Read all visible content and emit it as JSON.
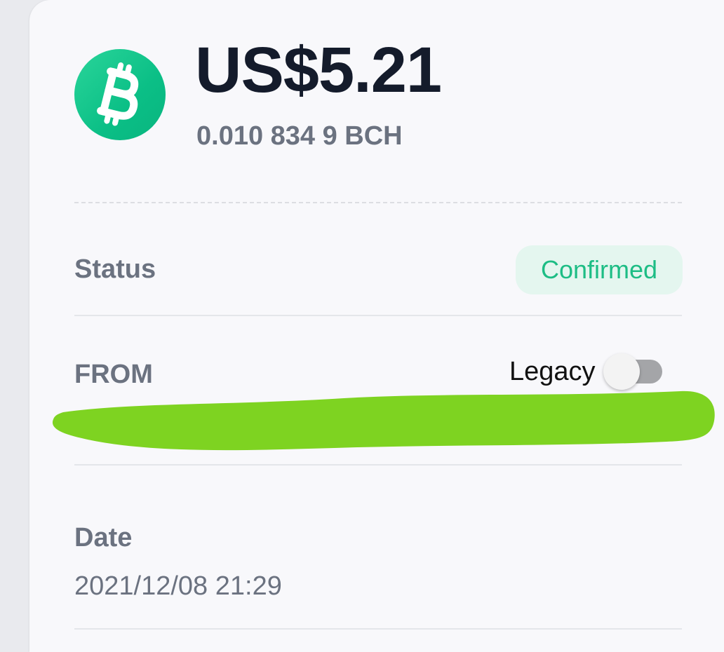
{
  "transaction": {
    "coin_icon": "bitcoin-cash-icon",
    "fiat_amount": "US$5.21",
    "crypto_amount": "0.010 834 9 BCH"
  },
  "status": {
    "label": "Status",
    "value": "Confirmed"
  },
  "from": {
    "label": "FROM",
    "legacy_label": "Legacy",
    "legacy_enabled": false
  },
  "date": {
    "label": "Date",
    "value": "2021/12/08 21:29"
  },
  "colors": {
    "accent_green": "#1dbd85",
    "coin_green": "#0bbf86",
    "badge_bg": "#e4f6ef",
    "redaction_green": "#7ed321"
  }
}
